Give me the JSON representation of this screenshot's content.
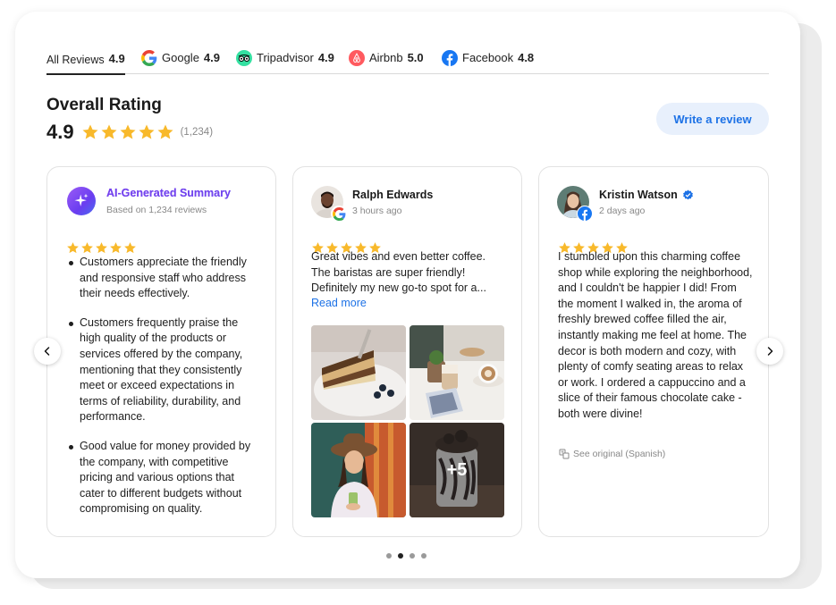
{
  "tabs": [
    {
      "label": "All Reviews",
      "score": "4.9",
      "icon": "all-reviews"
    },
    {
      "label": "Google",
      "score": "4.9",
      "icon": "google-icon"
    },
    {
      "label": "Tripadvisor",
      "score": "4.9",
      "icon": "tripadvisor-icon"
    },
    {
      "label": "Airbnb",
      "score": "5.0",
      "icon": "airbnb-icon"
    },
    {
      "label": "Facebook",
      "score": "4.8",
      "icon": "facebook-icon"
    }
  ],
  "overall": {
    "title": "Overall Rating",
    "score": "4.9",
    "stars": 5,
    "count": "(1,234)"
  },
  "write_review": "Write a review",
  "ai_summary": {
    "title": "AI-Generated Summary",
    "subtitle": "Based on 1,234 reviews",
    "stars": 5,
    "bullets": [
      "Customers appreciate the friendly and responsive staff who address their needs effectively.",
      "Customers frequently praise the high quality of the products or services offered by the company, mentioning that they consistently meet or exceed expectations in terms of reliability, durability, and performance.",
      "Good value for money provided by the company, with competitive pricing and various options that cater to different budgets without compromising on quality."
    ]
  },
  "reviews": [
    {
      "name": "Ralph Edwards",
      "time": "3 hours ago",
      "source": "google-icon",
      "stars": 5,
      "text": "Great vibes and even better coffee. The baristas are super friendly! Definitely my new go-to spot for a...",
      "read_more": "Read more",
      "photos_more": "+5"
    },
    {
      "name": "Kristin Watson",
      "time": "2 days ago",
      "source": "facebook-icon",
      "verified": true,
      "stars": 5,
      "text": "I stumbled upon this charming coffee shop while exploring the neighborhood, and I couldn't be happier I did! From the moment I walked in, the aroma of freshly brewed coffee filled the air, instantly making me feel at home. The decor is both modern and cozy, with plenty of comfy seating areas to relax or work. I ordered a cappuccino and a slice of their famous chocolate cake - both were divine!",
      "see_original": "See original (Spanish)"
    }
  ],
  "pagination": {
    "pages": 4,
    "current": 2
  },
  "colors": {
    "star": "#f8b92b",
    "accent": "#1d72e6",
    "button_bg": "#e8f0fc"
  }
}
